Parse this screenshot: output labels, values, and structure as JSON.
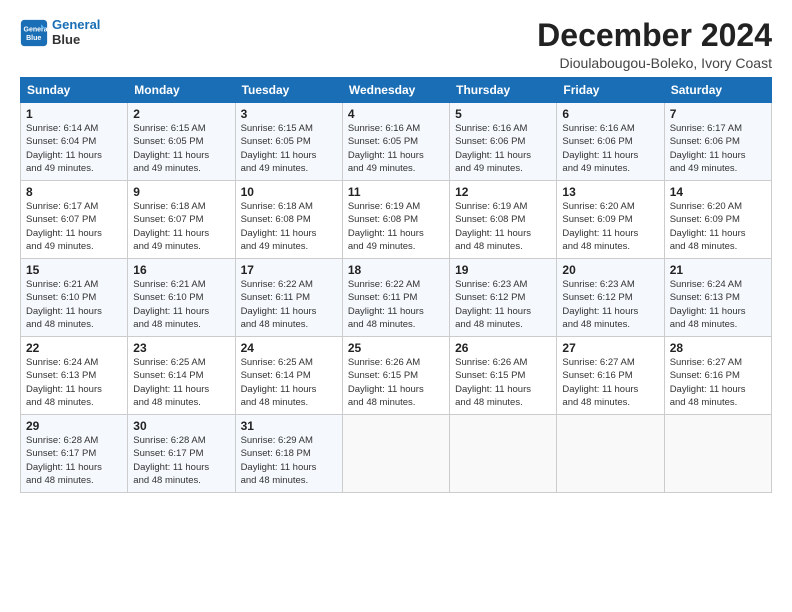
{
  "header": {
    "logo_line1": "General",
    "logo_line2": "Blue",
    "month": "December 2024",
    "location": "Dioulabougou-Boleko, Ivory Coast"
  },
  "days_of_week": [
    "Sunday",
    "Monday",
    "Tuesday",
    "Wednesday",
    "Thursday",
    "Friday",
    "Saturday"
  ],
  "weeks": [
    [
      {
        "day": "1",
        "info": "Sunrise: 6:14 AM\nSunset: 6:04 PM\nDaylight: 11 hours\nand 49 minutes."
      },
      {
        "day": "2",
        "info": "Sunrise: 6:15 AM\nSunset: 6:05 PM\nDaylight: 11 hours\nand 49 minutes."
      },
      {
        "day": "3",
        "info": "Sunrise: 6:15 AM\nSunset: 6:05 PM\nDaylight: 11 hours\nand 49 minutes."
      },
      {
        "day": "4",
        "info": "Sunrise: 6:16 AM\nSunset: 6:05 PM\nDaylight: 11 hours\nand 49 minutes."
      },
      {
        "day": "5",
        "info": "Sunrise: 6:16 AM\nSunset: 6:06 PM\nDaylight: 11 hours\nand 49 minutes."
      },
      {
        "day": "6",
        "info": "Sunrise: 6:16 AM\nSunset: 6:06 PM\nDaylight: 11 hours\nand 49 minutes."
      },
      {
        "day": "7",
        "info": "Sunrise: 6:17 AM\nSunset: 6:06 PM\nDaylight: 11 hours\nand 49 minutes."
      }
    ],
    [
      {
        "day": "8",
        "info": "Sunrise: 6:17 AM\nSunset: 6:07 PM\nDaylight: 11 hours\nand 49 minutes."
      },
      {
        "day": "9",
        "info": "Sunrise: 6:18 AM\nSunset: 6:07 PM\nDaylight: 11 hours\nand 49 minutes."
      },
      {
        "day": "10",
        "info": "Sunrise: 6:18 AM\nSunset: 6:08 PM\nDaylight: 11 hours\nand 49 minutes."
      },
      {
        "day": "11",
        "info": "Sunrise: 6:19 AM\nSunset: 6:08 PM\nDaylight: 11 hours\nand 49 minutes."
      },
      {
        "day": "12",
        "info": "Sunrise: 6:19 AM\nSunset: 6:08 PM\nDaylight: 11 hours\nand 48 minutes."
      },
      {
        "day": "13",
        "info": "Sunrise: 6:20 AM\nSunset: 6:09 PM\nDaylight: 11 hours\nand 48 minutes."
      },
      {
        "day": "14",
        "info": "Sunrise: 6:20 AM\nSunset: 6:09 PM\nDaylight: 11 hours\nand 48 minutes."
      }
    ],
    [
      {
        "day": "15",
        "info": "Sunrise: 6:21 AM\nSunset: 6:10 PM\nDaylight: 11 hours\nand 48 minutes."
      },
      {
        "day": "16",
        "info": "Sunrise: 6:21 AM\nSunset: 6:10 PM\nDaylight: 11 hours\nand 48 minutes."
      },
      {
        "day": "17",
        "info": "Sunrise: 6:22 AM\nSunset: 6:11 PM\nDaylight: 11 hours\nand 48 minutes."
      },
      {
        "day": "18",
        "info": "Sunrise: 6:22 AM\nSunset: 6:11 PM\nDaylight: 11 hours\nand 48 minutes."
      },
      {
        "day": "19",
        "info": "Sunrise: 6:23 AM\nSunset: 6:12 PM\nDaylight: 11 hours\nand 48 minutes."
      },
      {
        "day": "20",
        "info": "Sunrise: 6:23 AM\nSunset: 6:12 PM\nDaylight: 11 hours\nand 48 minutes."
      },
      {
        "day": "21",
        "info": "Sunrise: 6:24 AM\nSunset: 6:13 PM\nDaylight: 11 hours\nand 48 minutes."
      }
    ],
    [
      {
        "day": "22",
        "info": "Sunrise: 6:24 AM\nSunset: 6:13 PM\nDaylight: 11 hours\nand 48 minutes."
      },
      {
        "day": "23",
        "info": "Sunrise: 6:25 AM\nSunset: 6:14 PM\nDaylight: 11 hours\nand 48 minutes."
      },
      {
        "day": "24",
        "info": "Sunrise: 6:25 AM\nSunset: 6:14 PM\nDaylight: 11 hours\nand 48 minutes."
      },
      {
        "day": "25",
        "info": "Sunrise: 6:26 AM\nSunset: 6:15 PM\nDaylight: 11 hours\nand 48 minutes."
      },
      {
        "day": "26",
        "info": "Sunrise: 6:26 AM\nSunset: 6:15 PM\nDaylight: 11 hours\nand 48 minutes."
      },
      {
        "day": "27",
        "info": "Sunrise: 6:27 AM\nSunset: 6:16 PM\nDaylight: 11 hours\nand 48 minutes."
      },
      {
        "day": "28",
        "info": "Sunrise: 6:27 AM\nSunset: 6:16 PM\nDaylight: 11 hours\nand 48 minutes."
      }
    ],
    [
      {
        "day": "29",
        "info": "Sunrise: 6:28 AM\nSunset: 6:17 PM\nDaylight: 11 hours\nand 48 minutes."
      },
      {
        "day": "30",
        "info": "Sunrise: 6:28 AM\nSunset: 6:17 PM\nDaylight: 11 hours\nand 48 minutes."
      },
      {
        "day": "31",
        "info": "Sunrise: 6:29 AM\nSunset: 6:18 PM\nDaylight: 11 hours\nand 48 minutes."
      },
      {
        "day": "",
        "info": ""
      },
      {
        "day": "",
        "info": ""
      },
      {
        "day": "",
        "info": ""
      },
      {
        "day": "",
        "info": ""
      }
    ]
  ]
}
